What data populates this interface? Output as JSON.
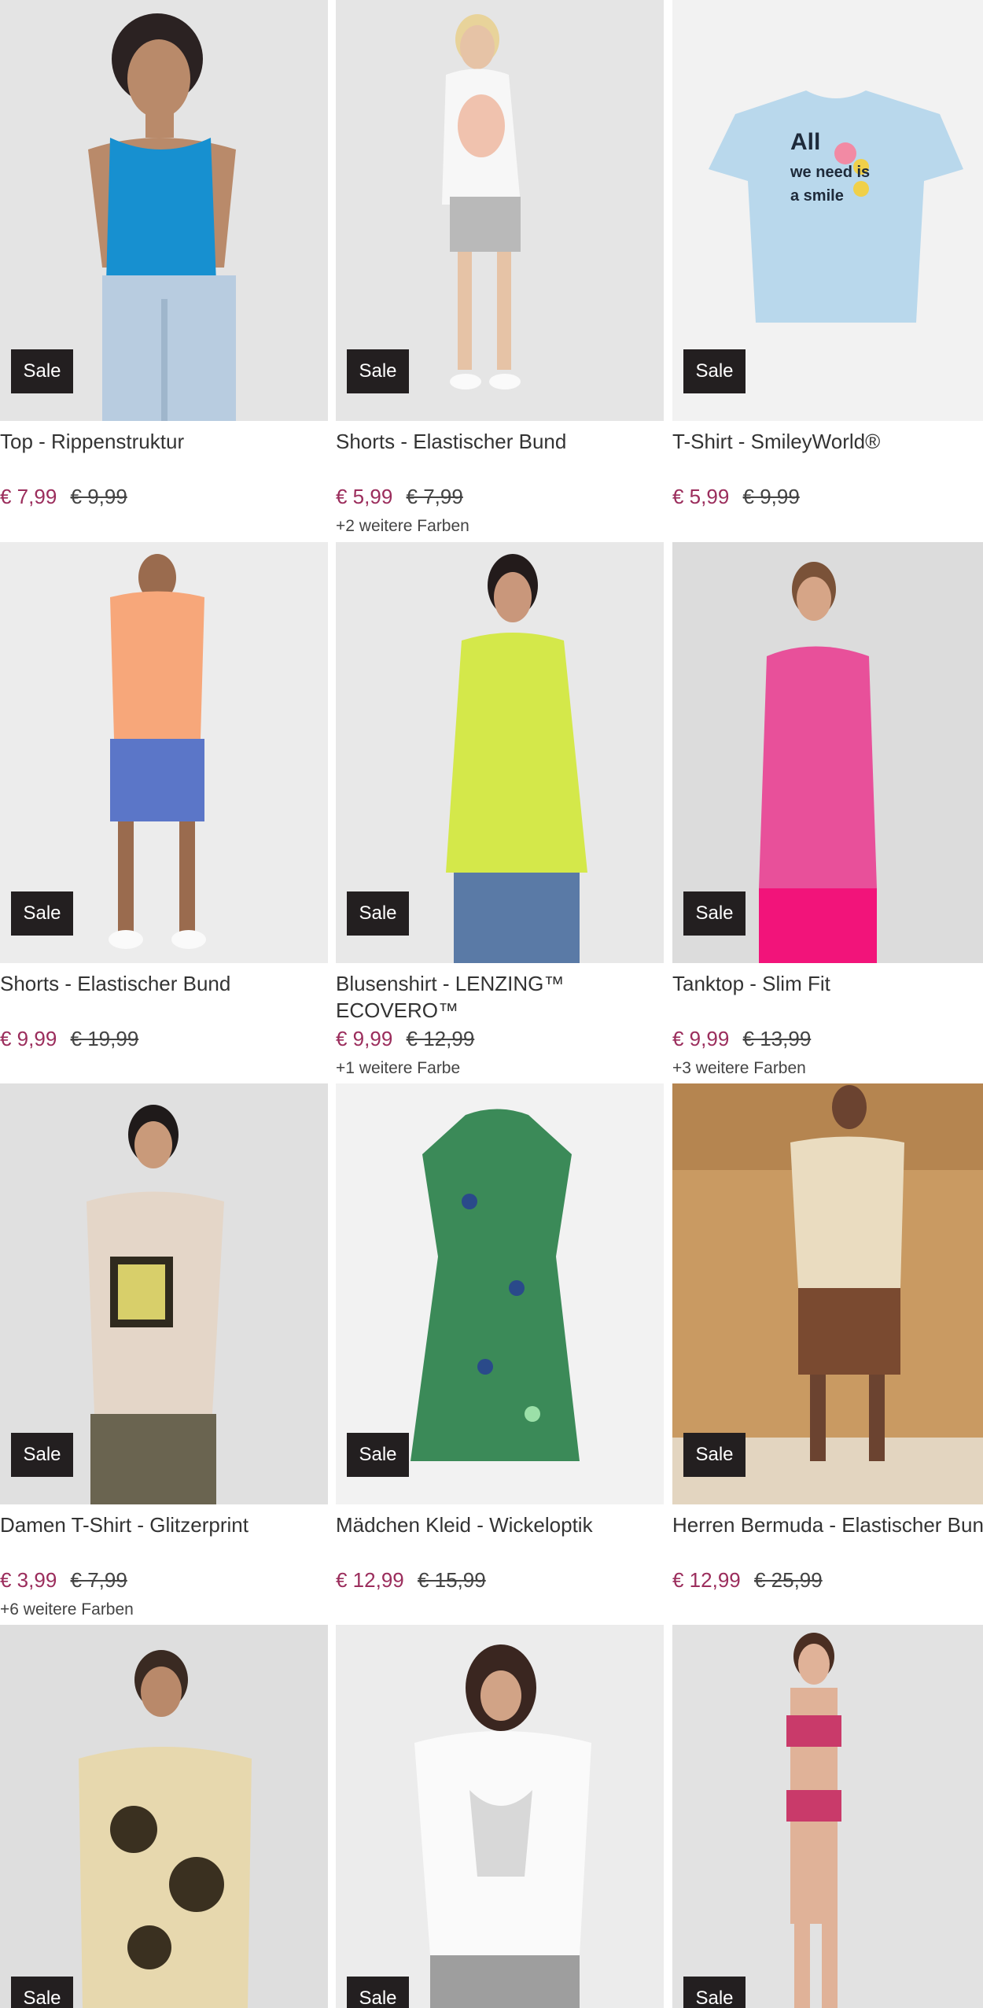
{
  "colors": {
    "sale_badge_bg": "#231f20",
    "price_now": "#9b2d5c"
  },
  "products": [
    {
      "title": "Top - Rippenstruktur",
      "badge": "Sale",
      "price": "€ 7,99",
      "old_price": "€ 9,99",
      "more": "",
      "img": "woman-blue-tank-top-photo"
    },
    {
      "title": "Shorts - Elastischer Bund",
      "badge": "Sale",
      "price": "€ 5,99",
      "old_price": "€ 7,99",
      "more": "+2 weitere Farben",
      "img": "woman-grey-shorts-photo"
    },
    {
      "title": "T-Shirt - SmileyWorld®",
      "badge": "Sale",
      "price": "€ 5,99",
      "old_price": "€ 9,99",
      "more": "",
      "img": "light-blue-tshirt-photo",
      "shirt_print": "All we need is a smile"
    },
    {
      "title": "Shorts - Elastischer Bund",
      "badge": "Sale",
      "price": "€ 9,99",
      "old_price": "€ 19,99",
      "more": "",
      "img": "man-blue-batik-shorts-photo"
    },
    {
      "title": "Blusenshirt - LENZING™ ECOVERO™",
      "badge": "Sale",
      "price": "€ 9,99",
      "old_price": "€ 12,99",
      "more": "+1 weitere Farbe",
      "img": "woman-lime-blouse-photo"
    },
    {
      "title": "Tanktop - Slim Fit",
      "badge": "Sale",
      "price": "€ 9,99",
      "old_price": "€ 13,99",
      "more": "+3 weitere Farben",
      "img": "woman-pink-tank-top-photo"
    },
    {
      "title": "Damen T-Shirt - Glitzerprint",
      "badge": "Sale",
      "price": "€ 3,99",
      "old_price": "€ 7,99",
      "more": "+6 weitere Farben",
      "img": "woman-beige-tshirt-photo"
    },
    {
      "title": "Mädchen Kleid - Wickeloptik",
      "badge": "Sale",
      "price": "€ 12,99",
      "old_price": "€ 15,99",
      "more": "",
      "img": "green-print-dress-photo"
    },
    {
      "title": "Herren Bermuda - Elastischer Bund",
      "badge": "Sale",
      "price": "€ 12,99",
      "old_price": "€ 25,99",
      "more": "",
      "img": "man-brown-bermuda-photo"
    },
    {
      "title": "",
      "badge": "Sale",
      "price": "",
      "old_price": "",
      "more": "",
      "img": "man-batik-tshirt-photo"
    },
    {
      "title": "",
      "badge": "Sale",
      "price": "",
      "old_price": "",
      "more": "",
      "img": "woman-white-butterfly-tshirt-photo"
    },
    {
      "title": "",
      "badge": "Sale",
      "price": "",
      "old_price": "",
      "more": "",
      "img": "woman-pink-bikini-photo"
    }
  ]
}
